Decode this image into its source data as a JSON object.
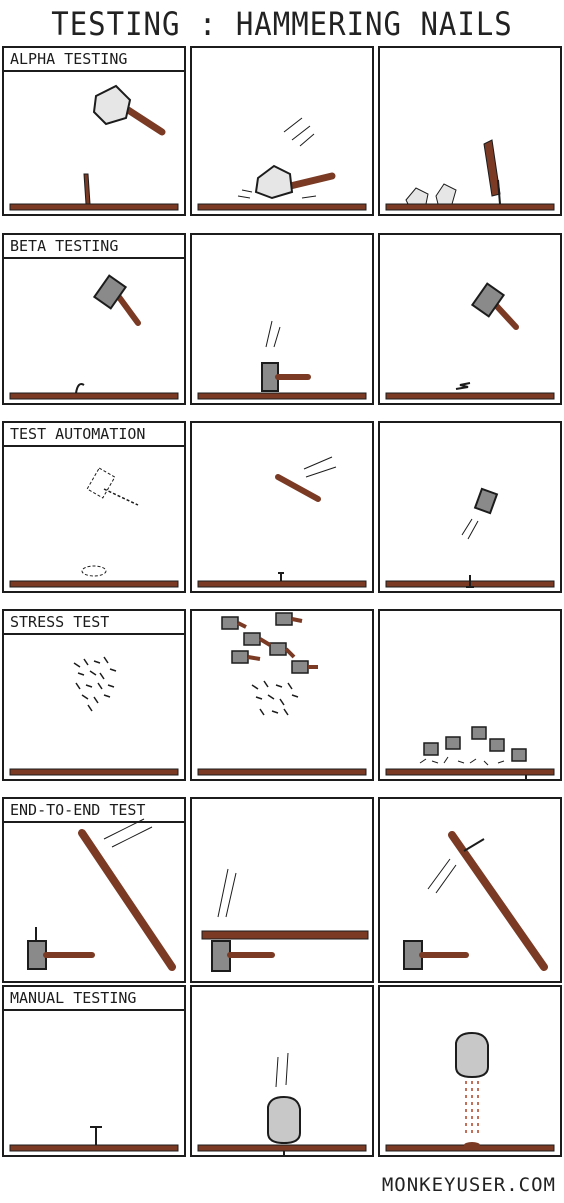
{
  "title": "TESTING : HAMMERING NAILS",
  "rows": [
    {
      "label": "ALPHA TESTING"
    },
    {
      "label": "BETA TESTING"
    },
    {
      "label": "TEST AUTOMATION"
    },
    {
      "label": "STRESS TEST"
    },
    {
      "label": "END-TO-END TEST"
    },
    {
      "label": "MANUAL TESTING"
    }
  ],
  "footer": "MONKEYUSER.COM",
  "colors": {
    "wood": "#7a3a24",
    "metal": "#8a8a8a",
    "skin": "#c8c8c8",
    "ink": "#1c1c1c"
  }
}
